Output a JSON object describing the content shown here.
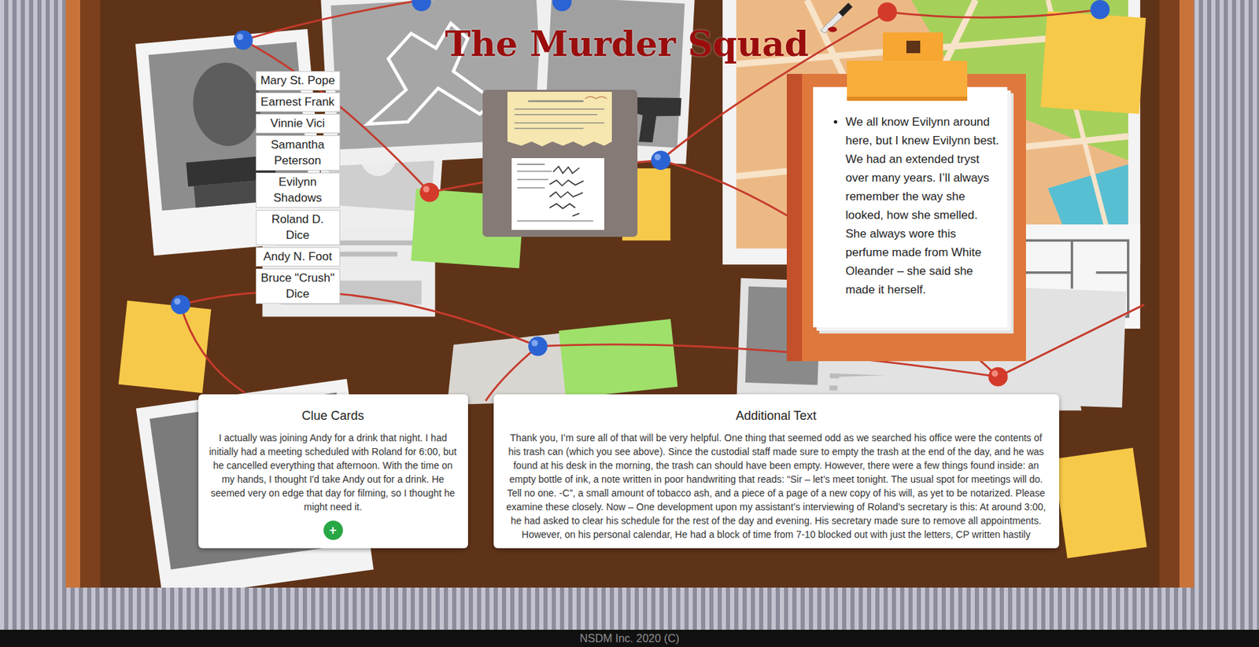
{
  "title": "The Murder Squad",
  "suspects": [
    "Mary St. Pope",
    "Earnest Frank",
    "Vinnie Vici",
    "Samantha Peterson",
    "Evilynn Shadows",
    "Roland D. Dice",
    "Andy N. Foot",
    "Bruce \"Crush\" Dice"
  ],
  "testimony": [
    "We all know Evilynn around here, but I knew Evilynn best. We had an extended tryst over many years. I’ll always remember the way she looked, how she smelled. She always wore this perfume made from White Oleander – she said she made it herself."
  ],
  "clue_cards": {
    "title": "Clue Cards",
    "text": "I actually was joining Andy for a drink that night. I had initially had a meeting scheduled with Roland for 6:00, but he cancelled everything that afternoon. With the time on my hands, I thought I'd take Andy out for a drink. He seemed very on edge that day for filming, so I thought he might need it.",
    "add_button": "+"
  },
  "additional_text": {
    "title": "Additional Text",
    "text": "Thank you, I’m sure all of that will be very helpful. One thing that seemed odd as we searched his office were the contents of his trash can (which you see above). Since the custodial staff made sure to empty the trash at the end of the day, and he was found at his desk in the morning, the trash can should have been empty. However, there were a few things found inside: an empty bottle of ink, a note written in poor handwriting that reads: “Sir – let’s meet tonight. The usual spot for meetings will do. Tell no one. -C”, a small amount of tobacco ash, and a piece of a page of a new copy of his will, as yet to be notarized. Please examine these closely. Now – One development upon my assistant’s interviewing of Roland’s secretary is this: At around 3:00, he had asked to clear his schedule for the rest of the day and evening. His secretary made sure to remove all appointments. However, on his personal calendar, He had a block of time from 7-10 blocked out with just the letters, CP written hastily"
  },
  "footer": "NSDM Inc. 2020 (C)"
}
